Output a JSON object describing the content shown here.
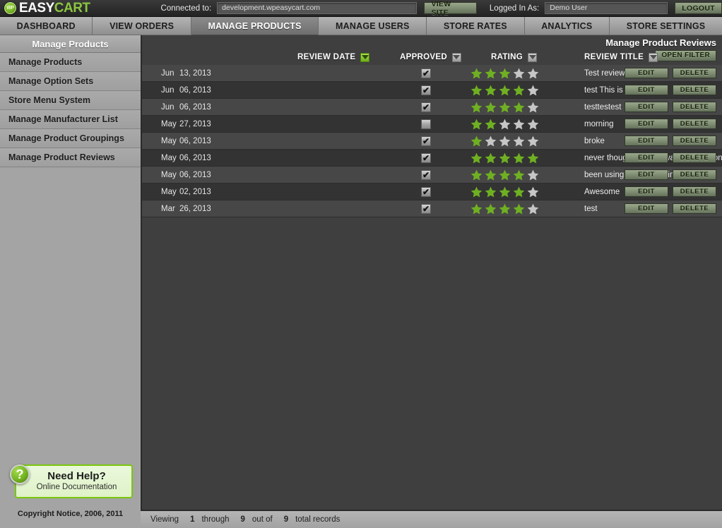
{
  "topbar": {
    "logo_primary": "EASY",
    "logo_secondary": "CART",
    "logo_badge": "WP",
    "connected_label": "Connected to:",
    "connected_value": "development.wpeasycart.com",
    "view_site_label": "VIEW SITE",
    "logged_in_label": "Logged In As:",
    "logged_in_value": "Demo User",
    "logout_label": "LOGOUT"
  },
  "nav": {
    "tabs": [
      {
        "label": "DASHBOARD",
        "active": false
      },
      {
        "label": "VIEW ORDERS",
        "active": false
      },
      {
        "label": "MANAGE PRODUCTS",
        "active": true
      },
      {
        "label": "MANAGE USERS",
        "active": false
      },
      {
        "label": "STORE RATES",
        "active": false
      },
      {
        "label": "ANALYTICS",
        "active": false
      },
      {
        "label": "STORE SETTINGS",
        "active": false
      }
    ]
  },
  "sidebar": {
    "title": "Manage Products",
    "items": [
      {
        "label": "Manage Products"
      },
      {
        "label": "Manage Option Sets"
      },
      {
        "label": "Store Menu System"
      },
      {
        "label": "Manage Manufacturer List"
      },
      {
        "label": "Manage Product Groupings"
      },
      {
        "label": "Manage Product Reviews"
      }
    ],
    "help": {
      "icon": "question-mark-icon",
      "title": "Need Help?",
      "subtitle": "Online Documentation"
    },
    "copyright": "Copyright Notice, 2006, 2011"
  },
  "main": {
    "page_title": "Manage Product Reviews",
    "open_filter_label": "OPEN FILTER",
    "columns": [
      {
        "label": "REVIEW DATE",
        "sort_state": "active"
      },
      {
        "label": "APPROVED",
        "sort_state": "inactive"
      },
      {
        "label": "RATING",
        "sort_state": "inactive"
      },
      {
        "label": "REVIEW TITLE",
        "sort_state": "inactive"
      }
    ],
    "row_actions": {
      "edit_label": "EDIT",
      "delete_label": "DELETE"
    },
    "max_stars": 5,
    "rows": [
      {
        "month": "Jun",
        "day": "13",
        "year": "2013",
        "date": "Jun  13, 2013",
        "approved": true,
        "rating": 3,
        "title": "Test review..."
      },
      {
        "month": "Jun",
        "day": "06",
        "year": "2013",
        "date": "Jun  06, 2013",
        "approved": true,
        "rating": 4,
        "title": "test This is a test. Test"
      },
      {
        "month": "Jun",
        "day": "06",
        "year": "2013",
        "date": "Jun  06, 2013",
        "approved": true,
        "rating": 4,
        "title": "testtestest"
      },
      {
        "month": "May",
        "day": "27",
        "year": "2013",
        "date": "May  27, 2013",
        "approved": false,
        "rating": 2,
        "title": "morning"
      },
      {
        "month": "May",
        "day": "06",
        "year": "2013",
        "date": "May  06, 2013",
        "approved": true,
        "rating": 1,
        "title": "broke"
      },
      {
        "month": "May",
        "day": "06",
        "year": "2013",
        "date": "May  06, 2013",
        "approved": true,
        "rating": 5,
        "title": "never thought I would want another one"
      },
      {
        "month": "May",
        "day": "06",
        "year": "2013",
        "date": "May  06, 2013",
        "approved": true,
        "rating": 4,
        "title": "been using this a long time"
      },
      {
        "month": "May",
        "day": "02",
        "year": "2013",
        "date": "May  02, 2013",
        "approved": true,
        "rating": 4,
        "title": "Awesome"
      },
      {
        "month": "Mar",
        "day": "26",
        "year": "2013",
        "date": "Mar  26, 2013",
        "approved": true,
        "rating": 4,
        "title": "test"
      }
    ]
  },
  "footer": {
    "viewing_label": "Viewing",
    "from": "1",
    "through_label": "through",
    "to": "9",
    "outof_label": "out of",
    "total": "9",
    "total_label": "total records"
  },
  "colors": {
    "brand_green": "#8cc63f",
    "star_filled": "#6fb022",
    "star_empty": "#c6c6c6",
    "panel_bg": "#3f3f3f",
    "row_odd": "#474747",
    "row_even": "#333333",
    "sidebar_bg": "#a4a4a4"
  }
}
